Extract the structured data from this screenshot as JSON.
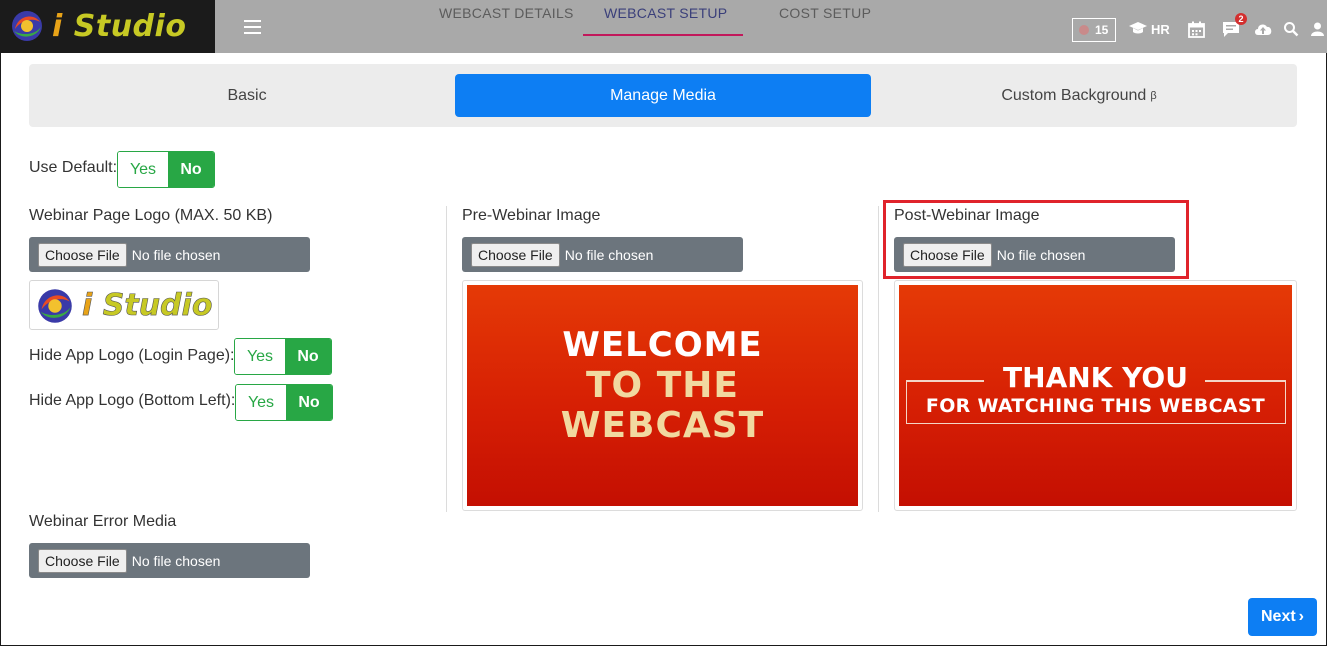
{
  "brand": {
    "name_i": "i",
    "name_rest": "Studio"
  },
  "topnav": {
    "tabs": [
      {
        "label": "WEBCAST DETAILS"
      },
      {
        "label": "WEBCAST SETUP"
      },
      {
        "label": "COST SETUP"
      }
    ],
    "active_tab": "WEBCAST SETUP",
    "rec_count": "15",
    "hr_label": "HR",
    "notification_count": "2",
    "icons": [
      "menu-icon",
      "record-icon",
      "graduation-cap-icon",
      "calendar-icon",
      "chat-icon",
      "cloud-upload-icon",
      "search-icon",
      "user-icon"
    ]
  },
  "subtabs": {
    "basic": "Basic",
    "manage_media": "Manage Media",
    "custom_background": "Custom Background",
    "beta_mark": "β",
    "active": "Manage Media"
  },
  "use_default": {
    "label": "Use Default:",
    "yes": "Yes",
    "no": "No",
    "value": "No"
  },
  "page_logo": {
    "label": "Webinar Page Logo (MAX. 50 KB)"
  },
  "hide_login_logo": {
    "label": "Hide App Logo (Login Page):",
    "yes": "Yes",
    "no": "No",
    "value": "No"
  },
  "hide_bottom_logo": {
    "label": "Hide App Logo (Bottom Left):",
    "yes": "Yes",
    "no": "No",
    "value": "No"
  },
  "pre_webinar": {
    "label": "Pre-Webinar Image",
    "image_lines": [
      "WELCOME",
      "TO THE",
      "WEBCAST"
    ]
  },
  "post_webinar": {
    "label": "Post-Webinar Image",
    "image_lines": [
      "THANK YOU",
      "FOR WATCHING THIS WEBCAST"
    ]
  },
  "error_media": {
    "label": "Webinar Error Media"
  },
  "file_input": {
    "button": "Choose File",
    "status": "No file chosen"
  },
  "next_button": {
    "label": "Next",
    "chevron": "›"
  },
  "colors": {
    "primary": "#0d7ef3",
    "toggle_green": "#28a745",
    "highlight_red": "#e0232b",
    "topbar": "#a9a9a9"
  }
}
